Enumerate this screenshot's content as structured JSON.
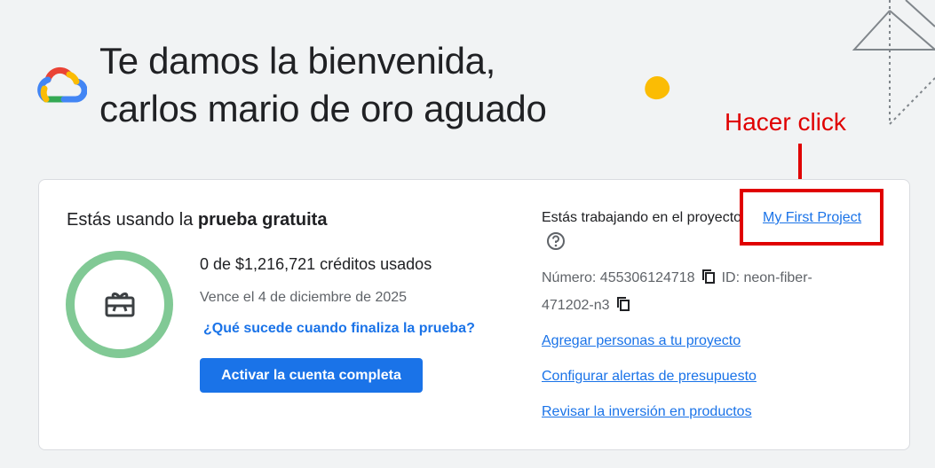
{
  "header": {
    "welcome_line1": "Te damos la bienvenida,",
    "welcome_line2": "carlos mario de oro aguado",
    "logo_icon": "google-cloud-logo-icon"
  },
  "annotation": {
    "label": "Hacer click",
    "color": "#e00000"
  },
  "trial": {
    "title_prefix": "Estás usando la ",
    "title_bold": "prueba gratuita",
    "credits_used": "0 de $1,216,721 créditos usados",
    "expires": "Vence el 4 de diciembre de 2025",
    "what_happens_link": "¿Qué sucede cuando finaliza la prueba?",
    "activate_button": "Activar la cuenta completa",
    "ring_color": "#81c995",
    "ring_icon": "gift-card-icon"
  },
  "project": {
    "working_in_label": "Estás trabajando en el proyecto",
    "project_name": "My First Project",
    "number_label": "Número: 455306124718",
    "id_label_part1": "ID: neon-fiber-",
    "id_label_part2": "471202-n3",
    "links": [
      "Agregar personas a tu proyecto",
      "Configurar alertas de presupuesto",
      "Revisar la inversión en productos"
    ]
  },
  "colors": {
    "accent": "#1a73e8",
    "background": "#f1f3f4",
    "deco_dot": "#fbbc04"
  }
}
